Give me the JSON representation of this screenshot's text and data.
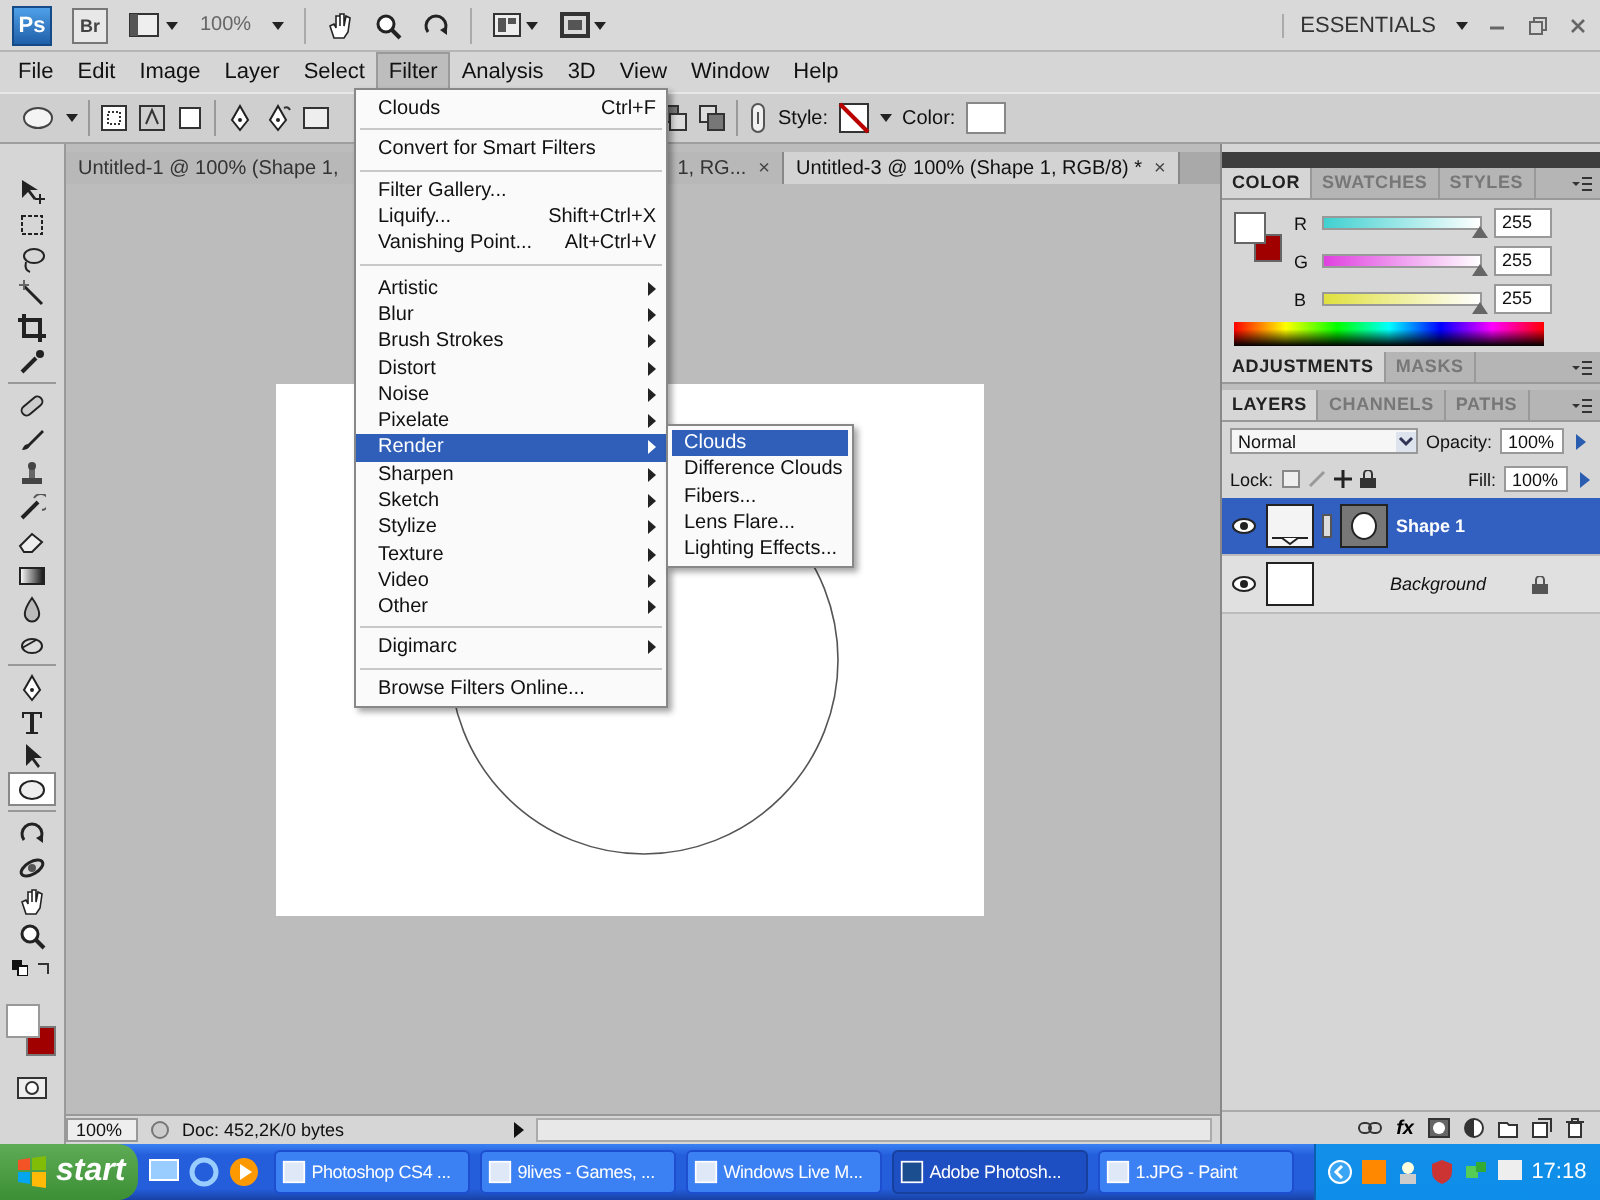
{
  "app_bar": {
    "logo": "Ps",
    "bridge": "Br",
    "zoom": "100%",
    "workspace": "ESSENTIALS"
  },
  "menu_bar": [
    {
      "label": "File",
      "selected": false
    },
    {
      "label": "Edit",
      "selected": false
    },
    {
      "label": "Image",
      "selected": false
    },
    {
      "label": "Layer",
      "selected": false
    },
    {
      "label": "Select",
      "selected": false
    },
    {
      "label": "Filter",
      "selected": true
    },
    {
      "label": "Analysis",
      "selected": false
    },
    {
      "label": "3D",
      "selected": false
    },
    {
      "label": "View",
      "selected": false
    },
    {
      "label": "Window",
      "selected": false
    },
    {
      "label": "Help",
      "selected": false
    }
  ],
  "options_bar": {
    "style_label": "Style:",
    "color_label": "Color:"
  },
  "tools": [
    {
      "kind": "move",
      "selected": false
    },
    {
      "kind": "marquee",
      "selected": false
    },
    {
      "kind": "lasso",
      "selected": false
    },
    {
      "kind": "wand",
      "selected": false
    },
    {
      "kind": "crop",
      "selected": false
    },
    {
      "kind": "eyedropper",
      "selected": false
    },
    {
      "kind": "bandage",
      "selected": false
    },
    {
      "kind": "brush",
      "selected": false
    },
    {
      "kind": "stamp",
      "selected": false
    },
    {
      "kind": "history",
      "selected": false
    },
    {
      "kind": "eraser",
      "selected": false
    },
    {
      "kind": "gradient",
      "selected": false
    },
    {
      "kind": "drop",
      "selected": false
    },
    {
      "kind": "dodge",
      "selected": false
    },
    {
      "kind": "pen",
      "selected": false
    },
    {
      "kind": "type",
      "selected": false
    },
    {
      "kind": "pointer",
      "selected": false
    },
    {
      "kind": "ellipse",
      "selected": true
    },
    {
      "kind": "rotate",
      "selected": false
    },
    {
      "kind": "orbit",
      "selected": false
    },
    {
      "kind": "hand",
      "selected": false
    },
    {
      "kind": "zoom",
      "selected": false
    }
  ],
  "document_tabs": [
    {
      "label": "Untitled-1 @ 100% (Shape 1,",
      "selected": false
    },
    {
      "label": "1, RG...",
      "close": "×",
      "selected": false
    },
    {
      "label": "Untitled-3 @ 100% (Shape 1, RGB/8) *",
      "close": "×",
      "selected": true
    }
  ],
  "filter_menu": {
    "groups": [
      [
        {
          "label": "Clouds",
          "shortcut": "Ctrl+F",
          "submenu": false,
          "selected": false
        }
      ],
      [
        {
          "label": "Convert for Smart Filters",
          "submenu": false,
          "selected": false
        }
      ],
      [
        {
          "label": "Filter Gallery...",
          "submenu": false,
          "selected": false
        },
        {
          "label": "Liquify...",
          "shortcut": "Shift+Ctrl+X",
          "submenu": false,
          "selected": false
        },
        {
          "label": "Vanishing Point...",
          "shortcut": "Alt+Ctrl+V",
          "submenu": false,
          "selected": false
        }
      ],
      [
        {
          "label": "Artistic",
          "submenu": true,
          "selected": false
        },
        {
          "label": "Blur",
          "submenu": true,
          "selected": false
        },
        {
          "label": "Brush Strokes",
          "submenu": true,
          "selected": false
        },
        {
          "label": "Distort",
          "submenu": true,
          "selected": false
        },
        {
          "label": "Noise",
          "submenu": true,
          "selected": false
        },
        {
          "label": "Pixelate",
          "submenu": true,
          "selected": false
        },
        {
          "label": "Render",
          "submenu": true,
          "selected": true
        },
        {
          "label": "Sharpen",
          "submenu": true,
          "selected": false
        },
        {
          "label": "Sketch",
          "submenu": true,
          "selected": false
        },
        {
          "label": "Stylize",
          "submenu": true,
          "selected": false
        },
        {
          "label": "Texture",
          "submenu": true,
          "selected": false
        },
        {
          "label": "Video",
          "submenu": true,
          "selected": false
        },
        {
          "label": "Other",
          "submenu": true,
          "selected": false
        }
      ],
      [
        {
          "label": "Digimarc",
          "submenu": true,
          "selected": false
        }
      ],
      [
        {
          "label": "Browse Filters Online...",
          "submenu": false,
          "selected": false
        }
      ]
    ]
  },
  "render_submenu": [
    {
      "label": "Clouds",
      "selected": true
    },
    {
      "label": "Difference Clouds",
      "selected": false
    },
    {
      "label": "Fibers...",
      "selected": false
    },
    {
      "label": "Lens Flare...",
      "selected": false
    },
    {
      "label": "Lighting Effects...",
      "selected": false
    }
  ],
  "color_panel": {
    "tabs": [
      {
        "label": "COLOR",
        "selected": true
      },
      {
        "label": "SWATCHES",
        "selected": false
      },
      {
        "label": "STYLES",
        "selected": false
      }
    ],
    "channels": [
      {
        "name": "R",
        "level": 1,
        "value": "255"
      },
      {
        "name": "G",
        "level": 1,
        "value": "255"
      },
      {
        "name": "B",
        "level": 1,
        "value": "255"
      }
    ]
  },
  "adjustments_panel": {
    "tabs": [
      {
        "label": "ADJUSTMENTS",
        "selected": true
      },
      {
        "label": "MASKS",
        "selected": false
      }
    ]
  },
  "layers_panel": {
    "tabs": [
      {
        "label": "LAYERS",
        "selected": true
      },
      {
        "label": "CHANNELS",
        "selected": false
      },
      {
        "label": "PATHS",
        "selected": false
      }
    ],
    "blend_mode": "Normal",
    "opacity_label": "Opacity:",
    "opacity": "100%",
    "lock_label": "Lock:",
    "fill_label": "Fill:",
    "fill": "100%",
    "layers": [
      {
        "name": "Shape 1",
        "kind": "shape",
        "selected": true,
        "visible": true,
        "locked": false
      },
      {
        "name": "Background",
        "kind": "background",
        "selected": false,
        "visible": true,
        "locked": true
      }
    ],
    "fx_button": "fx"
  },
  "status_bar": {
    "zoom": "100%",
    "doc_info": "Doc: 452,2K/0 bytes"
  },
  "taskbar": {
    "start": "start",
    "tasks": [
      {
        "label": "Photoshop CS4 ...",
        "selected": false
      },
      {
        "label": "9lives - Games, ...",
        "selected": false
      },
      {
        "label": "Windows Live M...",
        "selected": false
      },
      {
        "label": "Adobe Photosh...",
        "selected": true
      },
      {
        "label": "1.JPG - Paint",
        "selected": false
      }
    ],
    "clock": "17:18"
  }
}
